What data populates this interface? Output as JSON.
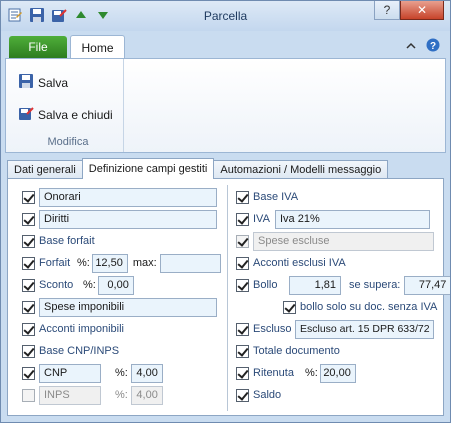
{
  "window": {
    "title": "Parcella"
  },
  "ribbon": {
    "file_tab": "File",
    "home_tab": "Home",
    "save": "Salva",
    "save_close": "Salva e chiudi",
    "group_label": "Modifica"
  },
  "tabs": [
    "Dati generali",
    "Definizione campi gestiti",
    "Automazioni / Modelli messaggio"
  ],
  "left": {
    "onorari": "Onorari",
    "diritti": "Diritti",
    "base_forfait": "Base forfait",
    "forfait": "Forfait",
    "forfait_pct_label": "%:",
    "forfait_pct": "12,50",
    "max_label": "max:",
    "max_value": "",
    "sconto": "Sconto",
    "sconto_pct_label": "%:",
    "sconto_pct": "0,00",
    "spese_imponibili": "Spese imponibili",
    "acconti_imponibili": "Acconti imponibili",
    "base_cnp": "Base CNP/INPS",
    "cnp": "CNP",
    "cnp_pct_label": "%:",
    "cnp_pct": "4,00",
    "inps": "INPS",
    "inps_pct_label": "%:",
    "inps_pct": "4,00"
  },
  "right": {
    "base_iva": "Base IVA",
    "iva": "IVA",
    "iva_value": "Iva 21%",
    "spese_escluse": "Spese escluse",
    "acconti_esclusi": "Acconti esclusi IVA",
    "bollo": "Bollo",
    "bollo_value": "1,81",
    "se_supera": "se supera:",
    "se_supera_value": "77,47",
    "bollo_solo": "bollo solo su doc. senza IVA",
    "escluso": "Escluso",
    "escluso_value": "Escluso art. 15 DPR 633/72",
    "totale_doc": "Totale documento",
    "ritenuta": "Ritenuta",
    "ritenuta_pct_label": "%:",
    "ritenuta_pct": "20,00",
    "saldo": "Saldo"
  },
  "colors": {
    "file_tab": "#2d7d1f",
    "label_blue": "#2b4a78",
    "input_blue": "#eaf4fc"
  },
  "icons": [
    "app-icon",
    "save-icon",
    "save-close-icon",
    "up-arrow-icon",
    "down-arrow-icon",
    "help-icon",
    "minimize-ribbon-icon"
  ]
}
